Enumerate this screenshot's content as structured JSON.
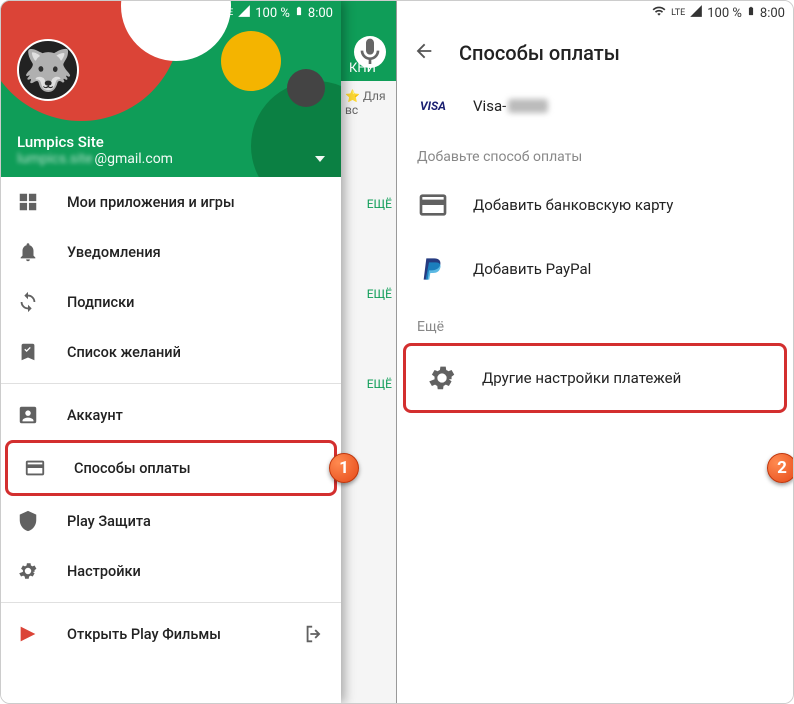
{
  "statusbar": {
    "lte": "LTE",
    "battery": "100 %",
    "time": "8:00"
  },
  "drawer": {
    "user_name": "Lumpics Site",
    "user_email_blur": "lumpics.site",
    "user_email_domain": "@gmail.com",
    "menu_group1": [
      {
        "label": "Мои приложения и игры",
        "icon": "apps"
      },
      {
        "label": "Уведомления",
        "icon": "bell"
      },
      {
        "label": "Подписки",
        "icon": "refresh"
      },
      {
        "label": "Список желаний",
        "icon": "bookmark"
      }
    ],
    "menu_group2": [
      {
        "label": "Аккаунт",
        "icon": "account"
      },
      {
        "label": "Способы оплаты",
        "icon": "card",
        "highlighted": true
      },
      {
        "label": "Play Защита",
        "icon": "shield"
      },
      {
        "label": "Настройки",
        "icon": "gear"
      }
    ],
    "menu_group3": [
      {
        "label": "Открыть Play Фильмы",
        "icon": "playfilms",
        "exit": true
      }
    ]
  },
  "play_bg": {
    "tab": "КНИ",
    "chip": "Для вс",
    "more": "ЕЩЁ"
  },
  "payment": {
    "title": "Способы оплаты",
    "visa_label": "Visa-",
    "section_add": "Добавьте способ оплаты",
    "add_card": "Добавить банковскую карту",
    "add_paypal": "Добавить PayPal",
    "section_more": "Ещё",
    "other_settings": "Другие настройки платежей"
  },
  "badges": {
    "one": "1",
    "two": "2"
  }
}
